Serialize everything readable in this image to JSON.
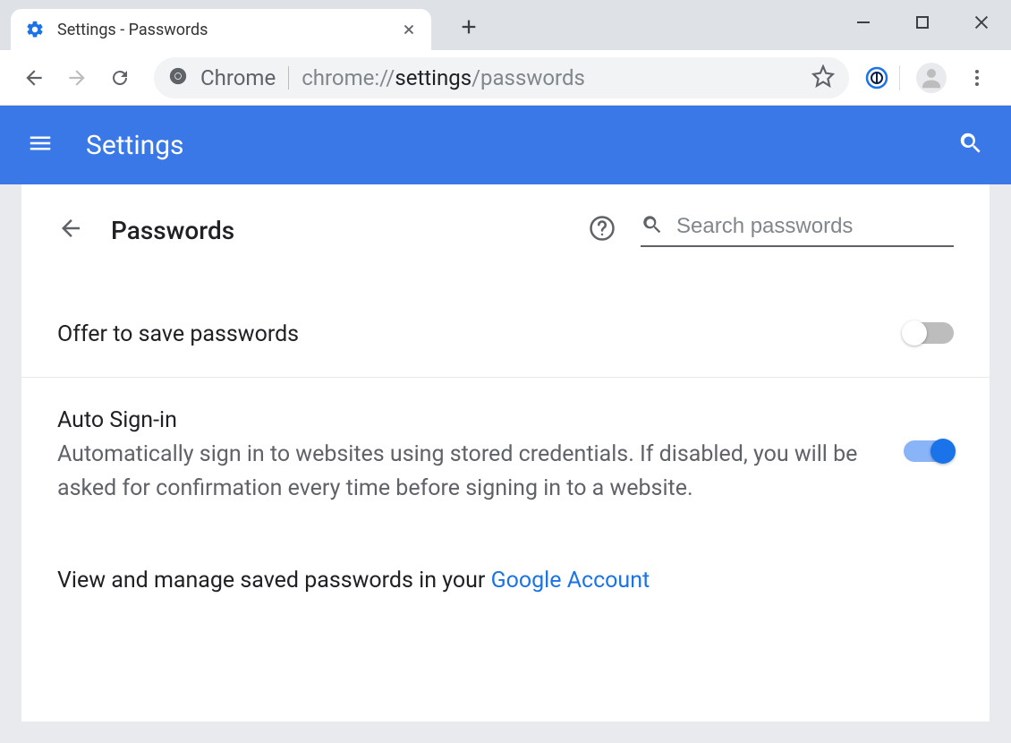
{
  "browser": {
    "tab_title": "Settings - Passwords",
    "omnibox_label": "Chrome",
    "url_prefix": "chrome://",
    "url_strong": "settings",
    "url_suffix": "/passwords"
  },
  "header": {
    "title": "Settings"
  },
  "page": {
    "title": "Passwords",
    "search_placeholder": "Search passwords"
  },
  "settings": {
    "offer_save": {
      "label": "Offer to save passwords",
      "enabled": false
    },
    "auto_signin": {
      "label": "Auto Sign-in",
      "description": "Automatically sign in to websites using stored credentials. If disabled, you will be asked for confirmation every time before signing in to a website.",
      "enabled": true
    },
    "manage_link": {
      "prefix": "View and manage saved passwords in your ",
      "link_text": "Google Account"
    }
  }
}
